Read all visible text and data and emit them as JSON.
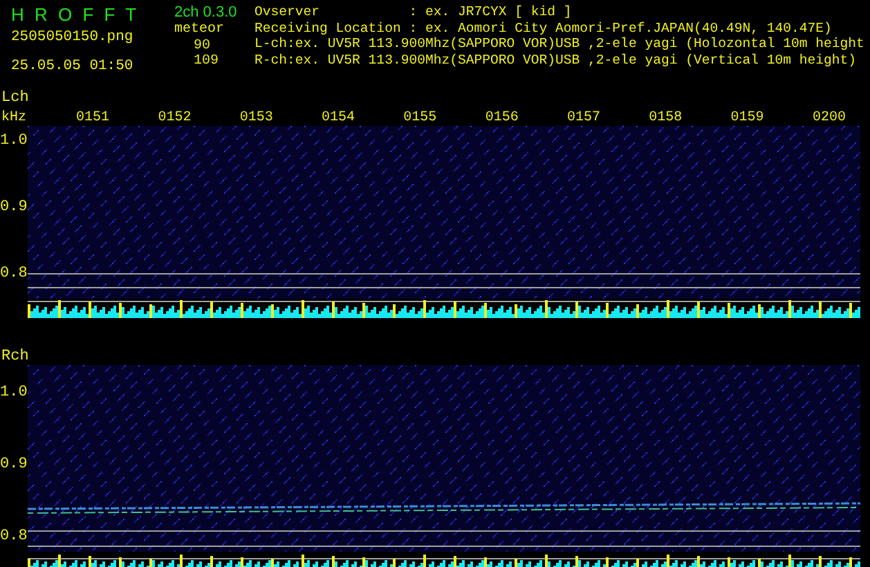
{
  "header": {
    "app_title": "H R O F F T",
    "version": "2ch 0.3.0",
    "filename": "2505050150.png",
    "datetime": "25.05.05 01:50",
    "counter_label": "meteor",
    "counts": [
      "90",
      "109"
    ],
    "info_lines": [
      "Ovserver           : ex. JR7CYX [ kid ]",
      "Receiving Location : ex. Aomori City Aomori-Pref.JAPAN(40.49N, 140.47E)",
      "L-ch:ex. UV5R 113.900Mhz(SAPPORO VOR)USB ,2-ele yagi (Holozontal 10m height",
      "R-ch:ex. UV5R 113.900Mhz(SAPPORO VOR)USB ,2-ele yagi (Vertical 10m height)"
    ]
  },
  "time_ticks": [
    "0151",
    "0152",
    "0153",
    "0154",
    "0155",
    "0156",
    "0157",
    "0158",
    "0159",
    "0200"
  ],
  "channels": [
    {
      "label": "Lch",
      "unit": "kHz",
      "freq_ticks": [
        "1.0",
        "0.9",
        "0.8"
      ]
    },
    {
      "label": "Rch",
      "freq_ticks": [
        "1.0",
        "0.9",
        "0.8"
      ]
    }
  ]
}
